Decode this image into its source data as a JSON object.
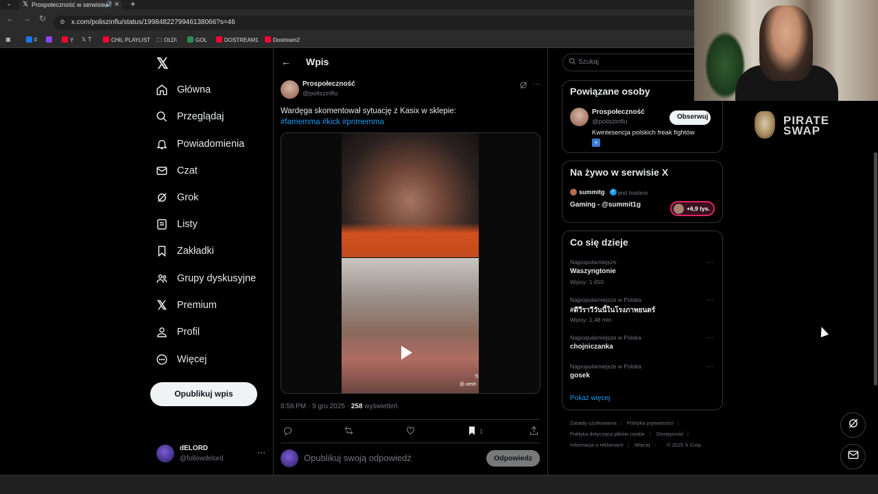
{
  "browser": {
    "tab_title": "Prospołeczność w serwisie X",
    "url": "x.com/poliszinflu/status/1998482279946138066?s=46",
    "bookmarks": [
      "F",
      "",
      "Y",
      "T",
      "CHIL PLAYLIST",
      "OLD\\",
      "GOL",
      "DOSTREAM1",
      "Dostream2"
    ]
  },
  "nav": {
    "items": [
      "Główna",
      "Przeglądaj",
      "Powiadomienia",
      "Czat",
      "Grok",
      "Listy",
      "Zakładki",
      "Grupy dyskusyjne",
      "Premium",
      "Profil",
      "Więcej"
    ],
    "post_button": "Opublikuj wpis"
  },
  "account": {
    "name": "dELORD",
    "handle": "@followdelord"
  },
  "main": {
    "title": "Wpis",
    "author_name": "Prospołeczność",
    "author_handle": "@poliszinflu",
    "text": "Wardęga skomentował sytuację z Kasix w sklepie:",
    "tags": [
      "#famemma",
      "#kick",
      "#primemma"
    ],
    "video_watermark": "@.oesh",
    "video_watermark2": "Ti",
    "timestamp": "8:58 PM · 9 gru 2025 · ",
    "views_count": "258",
    "views_label": " wyświetleń",
    "bookmark_count": "1",
    "reply_placeholder": "Opublikuj swoją odpowiedź",
    "reply_button": "Odpowiedz"
  },
  "sidebar": {
    "search_placeholder": "Szukaj",
    "related_title": "Powiązane osoby",
    "related_name": "Prospołeczność",
    "related_handle": "@poliszinflu",
    "related_bio": "Kwintesencja polskich freak fightów",
    "follow_button": "Obserwuj",
    "live_title": "Na żywo w serwisie X",
    "live_host": "summitg",
    "live_host_suffix": "jest hostem",
    "live_stream": "Gaming - @summit1g",
    "live_count": "+6,9 tys.",
    "trends_title": "Co się dzieje",
    "trends": [
      {
        "context": "Najpopularniejsze",
        "name": "Waszyngtonie",
        "count": "Wpisy: 1 650"
      },
      {
        "context": "Najpopularniejsze w Polska",
        "name": "#ดีวีราวีวันนี้ในโรงภาพยนตร์",
        "count": "Wpisy: 1,48 mln"
      },
      {
        "context": "Najpopularniejsze w Polska",
        "name": "chojniczanka",
        "count": ""
      },
      {
        "context": "Najpopularniejsze w Polska",
        "name": "gosek",
        "count": ""
      }
    ],
    "show_more": "Pokaż więcej",
    "footer": [
      "Zasady użytkowania",
      "Polityka prywatności",
      "Polityka dotycząca plików cookie",
      "Dostępność",
      "Informacja o reklamach",
      "Więcej ···",
      "© 2025 X Corp."
    ]
  },
  "brand": {
    "line1": "PIRATE",
    "line2": "SWAP"
  },
  "colors": {
    "accent": "#1d9bf0",
    "background": "#000000",
    "muted": "#71767b",
    "live": "#e0245e"
  }
}
